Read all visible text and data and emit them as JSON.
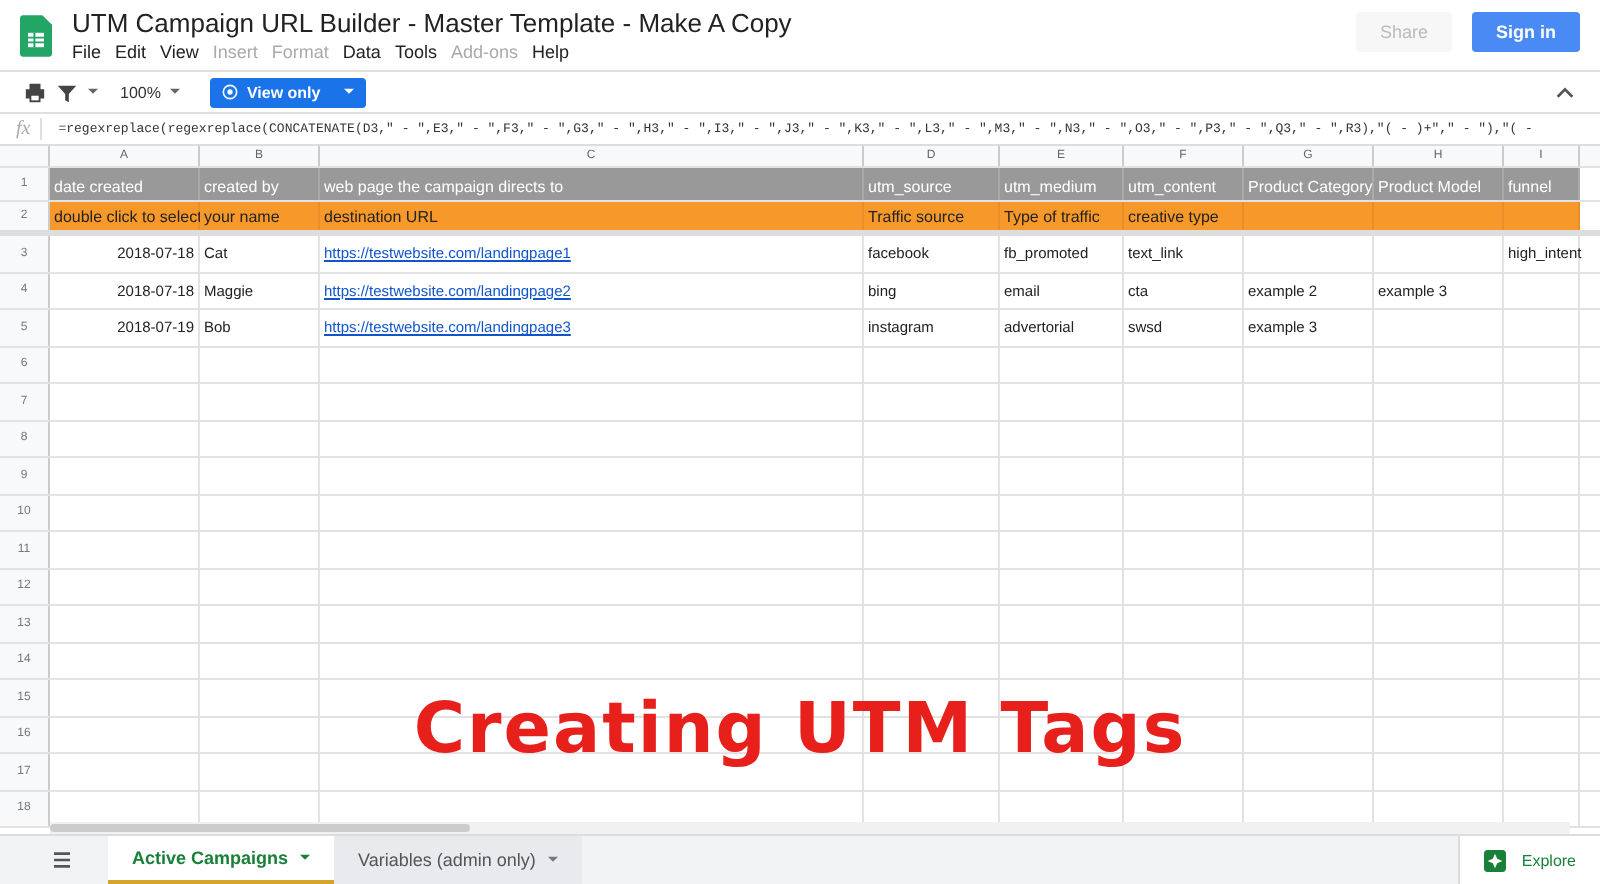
{
  "document": {
    "title": "UTM Campaign URL Builder - Master Template - Make A Copy"
  },
  "menu": [
    {
      "label": "File",
      "disabled": false
    },
    {
      "label": "Edit",
      "disabled": false
    },
    {
      "label": "View",
      "disabled": false
    },
    {
      "label": "Insert",
      "disabled": true
    },
    {
      "label": "Format",
      "disabled": true
    },
    {
      "label": "Data",
      "disabled": false
    },
    {
      "label": "Tools",
      "disabled": false
    },
    {
      "label": "Add-ons",
      "disabled": true
    },
    {
      "label": "Help",
      "disabled": false
    }
  ],
  "buttons": [
    {
      "label": "Share",
      "disabled": true
    },
    {
      "label": "Sign in",
      "disabled": false
    }
  ],
  "toolbar": {
    "zoom": "100%",
    "mode_button": "View only"
  },
  "formula_bar": {
    "label": "fx",
    "formula": "=regexreplace(regexreplace(CONCATENATE(D3,\" - \",E3,\" - \",F3,\" - \",G3,\" - \",H3,\" - \",I3,\" - \",J3,\" - \",K3,\" - \",L3,\" - \",M3,\" - \",N3,\" - \",O3,\" - \",P3,\" - \",Q3,\" - \",R3),\"( - )+\",\" - \"),\"( -"
  },
  "columns": [
    {
      "letter": "A",
      "kind": "date"
    },
    {
      "letter": "B",
      "kind": "text"
    },
    {
      "letter": "C",
      "kind": "link"
    },
    {
      "letter": "D",
      "kind": "text"
    },
    {
      "letter": "E",
      "kind": "text"
    },
    {
      "letter": "F",
      "kind": "text"
    },
    {
      "letter": "G",
      "kind": "text"
    },
    {
      "letter": "H",
      "kind": "text"
    },
    {
      "letter": "I",
      "kind": "text"
    }
  ],
  "rows": [
    {
      "number": "1",
      "kind": "header",
      "cells": [
        "date created",
        "created by",
        "web page the campaign directs to",
        "utm_source",
        "utm_medium",
        "utm_content",
        "Product Category",
        "Product Model",
        "funnel"
      ]
    },
    {
      "number": "2",
      "kind": "note",
      "cells": [
        "double click to select",
        "your name",
        "destination URL",
        "Traffic source",
        "Type of traffic",
        "creative type",
        null,
        null,
        null
      ]
    },
    {
      "number": "3",
      "kind": "data",
      "cells": [
        "2018-07-18",
        "Cat",
        "https://testwebsite.com/landingpage1",
        "facebook",
        "fb_promoted",
        "text_link",
        null,
        null,
        "high_intent"
      ]
    },
    {
      "number": "4",
      "kind": "data",
      "cells": [
        "2018-07-18",
        "Maggie",
        "https://testwebsite.com/landingpage2",
        "bing",
        "email",
        "cta",
        "example 2",
        "example 3",
        null
      ]
    },
    {
      "number": "5",
      "kind": "data",
      "cells": [
        "2018-07-19",
        "Bob",
        "https://testwebsite.com/landingpage3",
        "instagram",
        "advertorial",
        "swsd",
        "example 3",
        null,
        null
      ]
    }
  ],
  "empty_rows": [
    "6",
    "7",
    "8",
    "9",
    "10",
    "11",
    "12",
    "13",
    "14",
    "15",
    "16",
    "17",
    "18"
  ],
  "sheet_tabs": [
    {
      "label": "Active Campaigns",
      "selected": true
    },
    {
      "label": "Variables (admin only)",
      "selected": false
    }
  ],
  "explore_button": "Explore",
  "overlay_title": "Creating UTM Tags"
}
